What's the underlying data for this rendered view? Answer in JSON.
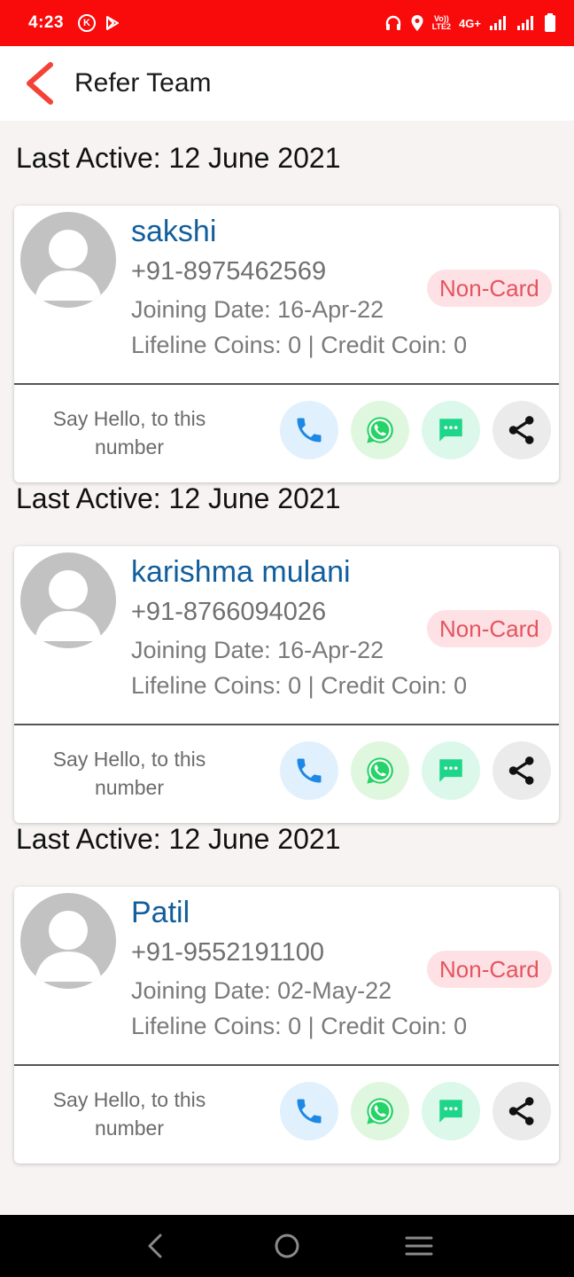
{
  "status_bar": {
    "time": "4:23",
    "k_badge": "K",
    "volte_top": "Vo))",
    "volte_bottom": "LTE2",
    "network": "4G+"
  },
  "app_bar": {
    "title": "Refer Team",
    "back_icon": "chevron-left-icon",
    "accent_color": "#f44336"
  },
  "team": [
    {
      "last_active": "Last Active: 12 June 2021",
      "name": "sakshi",
      "phone": "+91-8975462569",
      "joining": "Joining Date: 16-Apr-22",
      "coins": "Lifeline Coins: 0 | Credit Coin: 0",
      "badge": "Non-Card",
      "hello": "Say Hello, to this number"
    },
    {
      "last_active": "Last Active: 12 June 2021",
      "name": "karishma mulani",
      "phone": "+91-8766094026",
      "joining": "Joining Date: 16-Apr-22",
      "coins": "Lifeline Coins: 0 | Credit Coin: 0",
      "badge": "Non-Card",
      "hello": "Say Hello, to this number"
    },
    {
      "last_active": "Last Active: 12 June 2021",
      "name": "Patil",
      "phone": "+91-9552191100",
      "joining": "Joining Date: 02-May-22",
      "coins": "Lifeline Coins: 0 | Credit Coin: 0",
      "badge": "Non-Card",
      "hello": "Say Hello, to this number"
    }
  ],
  "action_icons": [
    "phone-icon",
    "whatsapp-icon",
    "sms-icon",
    "share-icon"
  ],
  "colors": {
    "status_bar": "#f90b0b",
    "name": "#125e9c",
    "badge_bg": "#fde1e4",
    "badge_text": "#e5545e",
    "call": "#1e88e5",
    "whatsapp": "#25d366",
    "sms": "#1ed68a"
  },
  "nav_icons": [
    "back-nav-icon",
    "home-nav-icon",
    "recents-nav-icon"
  ]
}
